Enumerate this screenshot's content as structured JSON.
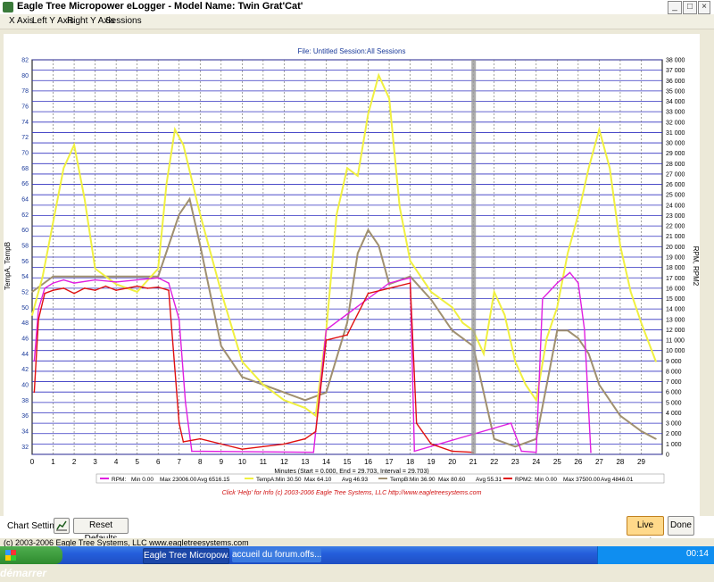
{
  "window": {
    "title": "Eagle Tree Micropower eLogger - Model Name: Twin Grat'Cat'"
  },
  "menu": [
    "X Axis",
    "Left Y Axis",
    "Right Y Axis",
    "Sessions"
  ],
  "chart_header": {
    "file_session": "File: Untitled   Session:All Sessions"
  },
  "chart_data": {
    "type": "line",
    "xlabel": "Minutes (Start = 0.000,  End = 29.703,  Interval = 29.703)",
    "ylabel_left": "TempA, TempB",
    "ylabel_right": "RPM, RPM2",
    "xlim": [
      0,
      30
    ],
    "ylim_left": [
      31,
      82
    ],
    "ylim_right": [
      0,
      38000
    ],
    "x_ticks": [
      "0",
      "1",
      "2",
      "3",
      "4",
      "5",
      "6",
      "7",
      "8",
      "9",
      "10",
      "11",
      "12",
      "13",
      "14",
      "15",
      "16",
      "17",
      "18",
      "19",
      "20",
      "21",
      "22",
      "23",
      "24",
      "25",
      "26",
      "27",
      "28",
      "29"
    ],
    "left_ticks": [
      "32",
      "34",
      "36",
      "38",
      "40",
      "42",
      "44",
      "46",
      "48",
      "50",
      "52",
      "54",
      "56",
      "58",
      "60",
      "62",
      "64",
      "66",
      "68",
      "70",
      "72",
      "74",
      "76",
      "78",
      "80",
      "82"
    ],
    "right_ticks": [
      "0",
      "1 000",
      "2 000",
      "3 000",
      "4 000",
      "5 000",
      "6 000",
      "7 000",
      "8 000",
      "9 000",
      "10 000",
      "11 000",
      "12 000",
      "13 000",
      "14 000",
      "15 000",
      "16 000",
      "17 000",
      "18 000",
      "19 000",
      "20 000",
      "21 000",
      "22 000",
      "23 000",
      "24 000",
      "25 000",
      "26 000",
      "27 000",
      "28 000",
      "29 000",
      "30 000",
      "31 000",
      "32 000",
      "33 000",
      "34 000",
      "35 000",
      "36 000",
      "37 000",
      "38 000"
    ],
    "grid": true,
    "series": [
      {
        "name": "RPM",
        "axis": "right",
        "color": "#e020e0",
        "x": [
          0.1,
          0.3,
          0.6,
          1.0,
          1.5,
          2.0,
          3.0,
          4.0,
          5.0,
          6.0,
          6.5,
          7.0,
          7.3,
          7.6,
          13.4,
          14.0,
          15.0,
          16.0,
          17.0,
          18.0,
          18.2,
          22.8,
          23.3,
          24.0,
          24.3,
          25.0,
          25.6,
          26.0,
          26.3,
          26.6
        ],
        "y": [
          9000,
          14000,
          16000,
          16500,
          16800,
          16500,
          16800,
          16600,
          16800,
          17000,
          16500,
          13000,
          5000,
          300,
          200,
          12000,
          13500,
          15000,
          16500,
          17000,
          300,
          3000,
          300,
          200,
          15000,
          16500,
          17500,
          16500,
          12000,
          200
        ],
        "min": "Min 0.00",
        "max": "Max 23006.00",
        "avg": "Avg 6516.15"
      },
      {
        "name": "TempA",
        "axis": "left",
        "color": "#f0f040",
        "x": [
          0,
          0.5,
          1.0,
          1.5,
          2.0,
          2.5,
          3.0,
          4.0,
          5.0,
          6.0,
          6.4,
          6.8,
          7.2,
          8.0,
          9.0,
          10.0,
          11.0,
          12.0,
          13.0,
          13.5,
          14.0,
          14.5,
          15.0,
          15.5,
          16.0,
          16.5,
          17.0,
          17.5,
          18.0,
          19.0,
          20.0,
          20.5,
          21.0,
          21.5,
          22.0,
          22.5,
          23.0,
          23.5,
          24.0,
          24.5,
          25.0,
          25.5,
          26.0,
          26.5,
          27.0,
          27.5,
          28.0,
          28.5,
          29.0,
          29.7
        ],
        "y": [
          49,
          54,
          61,
          68,
          71,
          64,
          55,
          53,
          52,
          55,
          66,
          73,
          71,
          62,
          52,
          43,
          40,
          38,
          37,
          36,
          47,
          62,
          68,
          67,
          75,
          80,
          77,
          63,
          56,
          52,
          50,
          48,
          47,
          44,
          52,
          49,
          43,
          40,
          38,
          46,
          50,
          57,
          62,
          68,
          73,
          68,
          58,
          52,
          48,
          43
        ],
        "min": "Min 30.50",
        "max": "Max 64.10",
        "avg": "Avg 46.93"
      },
      {
        "name": "TempB",
        "axis": "left",
        "color": "#a09070",
        "x": [
          0,
          1,
          2,
          3,
          4,
          5,
          6,
          6.5,
          7.0,
          7.5,
          8.0,
          9.0,
          10.0,
          11.0,
          12.0,
          13.0,
          14.0,
          15.0,
          15.5,
          16.0,
          16.5,
          17.0,
          18.0,
          19.0,
          20.0,
          21.0,
          22.0,
          23.0,
          24.0,
          24.5,
          25.0,
          25.5,
          26.0,
          26.5,
          27.0,
          28.0,
          29.0,
          29.7
        ],
        "y": [
          52,
          54,
          54,
          54,
          54,
          54,
          54,
          58,
          62,
          64,
          58,
          45,
          41,
          40,
          39,
          38,
          39,
          48,
          57,
          60,
          58,
          53,
          54,
          51,
          47,
          45,
          33,
          32,
          33,
          40,
          47,
          47,
          46,
          44,
          40,
          36,
          34,
          33
        ],
        "min": "Min 36.90",
        "max": "Max 80.60",
        "avg": "Avg 55.31"
      },
      {
        "name": "RPM2",
        "axis": "right",
        "color": "#e01010",
        "x": [
          0.1,
          0.3,
          0.6,
          1.0,
          1.5,
          2.0,
          2.5,
          3.0,
          3.5,
          4.0,
          4.5,
          5.0,
          5.5,
          6.0,
          6.5,
          7.0,
          7.2,
          8.0,
          10.0,
          12.0,
          13.0,
          13.5,
          14.0,
          15.0,
          16.0,
          17.0,
          18.0,
          18.3,
          19.0,
          20.0,
          21.0
        ],
        "y": [
          6000,
          13000,
          15500,
          15800,
          16000,
          15500,
          16000,
          15800,
          16200,
          15800,
          16000,
          16200,
          16000,
          16100,
          15800,
          3000,
          1200,
          1500,
          500,
          1000,
          1500,
          2200,
          11000,
          11500,
          15500,
          16000,
          16500,
          3000,
          1000,
          300,
          200
        ],
        "min": "Min 0.00",
        "max": "Max 37500.00",
        "avg": "Avg 4846.01"
      }
    ]
  },
  "legend": {
    "rpm_label": "RPM:",
    "rpm_min": "Min 0.00",
    "rpm_max": "Max 23006.00",
    "rpm_avg": "Avg 6516.15",
    "tempa_label": "TempA:",
    "tempa_min": "Min 30.50",
    "tempa_max": "Max 64.10",
    "tempa_avg": "Avg 46.93",
    "tempb_label": "TempB:",
    "tempb_min": "Min 36.90",
    "tempb_max": "Max 80.60",
    "tempb_avg": "Avg 55.31",
    "rpm2_label": "RPM2:",
    "rpm2_min": "Min 0.00",
    "rpm2_max": "Max 37500.00",
    "rpm2_avg": "Avg 4846.01"
  },
  "footer_note": "Click 'Help' for Info  (c) 2003-2006 Eagle Tree Systems, LLC     http://www.eagletreesystems.com",
  "bottom": {
    "chart_settings": "Chart Settings:",
    "reset_defaults": "Reset Defaults",
    "live_mode": "Live Mode",
    "done": "Done"
  },
  "status": "(c) 2003-2006 Eagle Tree Systems, LLC     www.eagletreesystems.com",
  "taskbar": {
    "start": "démarrer",
    "tasks": [
      "Eagle Tree Micropow...",
      "accueil du forum.offs..."
    ],
    "clock": "00:14"
  },
  "colors": {
    "grid_blue": "#3030c0",
    "axis": "#000000",
    "tray": "#0f8ef0"
  }
}
